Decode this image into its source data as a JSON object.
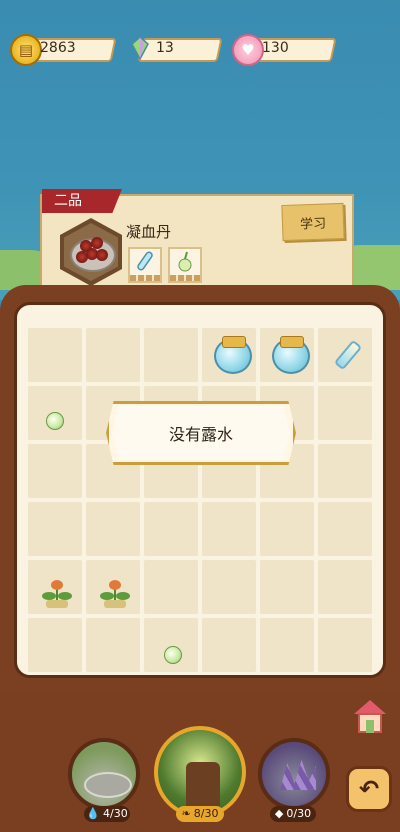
{
  "resources": {
    "gold": {
      "icon": "coin-icon",
      "value": "2863"
    },
    "gem": {
      "icon": "gem-icon",
      "value": "13"
    },
    "heart": {
      "icon": "heart-icon",
      "value": "130"
    }
  },
  "recipe": {
    "grade": "二品",
    "name": "凝血丹",
    "learn_label": "学习",
    "ingredients": [
      "vial-icon",
      "herb-orb-icon"
    ]
  },
  "toast": {
    "text": "没有露水"
  },
  "locations": [
    {
      "name": "pond",
      "count": "4/30",
      "count_icon": "water-drop-icon"
    },
    {
      "name": "tree-stump",
      "count": "8/30",
      "count_icon": "leaf-icon"
    },
    {
      "name": "crystal-cave",
      "count": "0/30",
      "count_icon": "crystal-icon"
    }
  ],
  "buttons": {
    "back": "back-arrow-icon",
    "house": "house-icon"
  },
  "colors": {
    "board": "#fbf3e2",
    "frame": "#7b3f22",
    "accent": "#e7a72b",
    "grade": "#a8272a"
  }
}
